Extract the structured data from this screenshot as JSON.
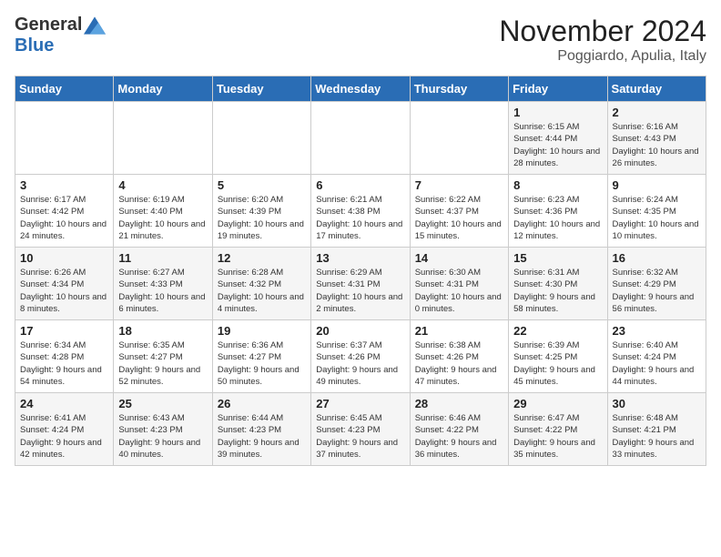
{
  "logo": {
    "general": "General",
    "blue": "Blue"
  },
  "title": "November 2024",
  "subtitle": "Poggiardo, Apulia, Italy",
  "days_of_week": [
    "Sunday",
    "Monday",
    "Tuesday",
    "Wednesday",
    "Thursday",
    "Friday",
    "Saturday"
  ],
  "weeks": [
    [
      {
        "day": "",
        "info": ""
      },
      {
        "day": "",
        "info": ""
      },
      {
        "day": "",
        "info": ""
      },
      {
        "day": "",
        "info": ""
      },
      {
        "day": "",
        "info": ""
      },
      {
        "day": "1",
        "info": "Sunrise: 6:15 AM\nSunset: 4:44 PM\nDaylight: 10 hours and 28 minutes."
      },
      {
        "day": "2",
        "info": "Sunrise: 6:16 AM\nSunset: 4:43 PM\nDaylight: 10 hours and 26 minutes."
      }
    ],
    [
      {
        "day": "3",
        "info": "Sunrise: 6:17 AM\nSunset: 4:42 PM\nDaylight: 10 hours and 24 minutes."
      },
      {
        "day": "4",
        "info": "Sunrise: 6:19 AM\nSunset: 4:40 PM\nDaylight: 10 hours and 21 minutes."
      },
      {
        "day": "5",
        "info": "Sunrise: 6:20 AM\nSunset: 4:39 PM\nDaylight: 10 hours and 19 minutes."
      },
      {
        "day": "6",
        "info": "Sunrise: 6:21 AM\nSunset: 4:38 PM\nDaylight: 10 hours and 17 minutes."
      },
      {
        "day": "7",
        "info": "Sunrise: 6:22 AM\nSunset: 4:37 PM\nDaylight: 10 hours and 15 minutes."
      },
      {
        "day": "8",
        "info": "Sunrise: 6:23 AM\nSunset: 4:36 PM\nDaylight: 10 hours and 12 minutes."
      },
      {
        "day": "9",
        "info": "Sunrise: 6:24 AM\nSunset: 4:35 PM\nDaylight: 10 hours and 10 minutes."
      }
    ],
    [
      {
        "day": "10",
        "info": "Sunrise: 6:26 AM\nSunset: 4:34 PM\nDaylight: 10 hours and 8 minutes."
      },
      {
        "day": "11",
        "info": "Sunrise: 6:27 AM\nSunset: 4:33 PM\nDaylight: 10 hours and 6 minutes."
      },
      {
        "day": "12",
        "info": "Sunrise: 6:28 AM\nSunset: 4:32 PM\nDaylight: 10 hours and 4 minutes."
      },
      {
        "day": "13",
        "info": "Sunrise: 6:29 AM\nSunset: 4:31 PM\nDaylight: 10 hours and 2 minutes."
      },
      {
        "day": "14",
        "info": "Sunrise: 6:30 AM\nSunset: 4:31 PM\nDaylight: 10 hours and 0 minutes."
      },
      {
        "day": "15",
        "info": "Sunrise: 6:31 AM\nSunset: 4:30 PM\nDaylight: 9 hours and 58 minutes."
      },
      {
        "day": "16",
        "info": "Sunrise: 6:32 AM\nSunset: 4:29 PM\nDaylight: 9 hours and 56 minutes."
      }
    ],
    [
      {
        "day": "17",
        "info": "Sunrise: 6:34 AM\nSunset: 4:28 PM\nDaylight: 9 hours and 54 minutes."
      },
      {
        "day": "18",
        "info": "Sunrise: 6:35 AM\nSunset: 4:27 PM\nDaylight: 9 hours and 52 minutes."
      },
      {
        "day": "19",
        "info": "Sunrise: 6:36 AM\nSunset: 4:27 PM\nDaylight: 9 hours and 50 minutes."
      },
      {
        "day": "20",
        "info": "Sunrise: 6:37 AM\nSunset: 4:26 PM\nDaylight: 9 hours and 49 minutes."
      },
      {
        "day": "21",
        "info": "Sunrise: 6:38 AM\nSunset: 4:26 PM\nDaylight: 9 hours and 47 minutes."
      },
      {
        "day": "22",
        "info": "Sunrise: 6:39 AM\nSunset: 4:25 PM\nDaylight: 9 hours and 45 minutes."
      },
      {
        "day": "23",
        "info": "Sunrise: 6:40 AM\nSunset: 4:24 PM\nDaylight: 9 hours and 44 minutes."
      }
    ],
    [
      {
        "day": "24",
        "info": "Sunrise: 6:41 AM\nSunset: 4:24 PM\nDaylight: 9 hours and 42 minutes."
      },
      {
        "day": "25",
        "info": "Sunrise: 6:43 AM\nSunset: 4:23 PM\nDaylight: 9 hours and 40 minutes."
      },
      {
        "day": "26",
        "info": "Sunrise: 6:44 AM\nSunset: 4:23 PM\nDaylight: 9 hours and 39 minutes."
      },
      {
        "day": "27",
        "info": "Sunrise: 6:45 AM\nSunset: 4:23 PM\nDaylight: 9 hours and 37 minutes."
      },
      {
        "day": "28",
        "info": "Sunrise: 6:46 AM\nSunset: 4:22 PM\nDaylight: 9 hours and 36 minutes."
      },
      {
        "day": "29",
        "info": "Sunrise: 6:47 AM\nSunset: 4:22 PM\nDaylight: 9 hours and 35 minutes."
      },
      {
        "day": "30",
        "info": "Sunrise: 6:48 AM\nSunset: 4:21 PM\nDaylight: 9 hours and 33 minutes."
      }
    ]
  ]
}
